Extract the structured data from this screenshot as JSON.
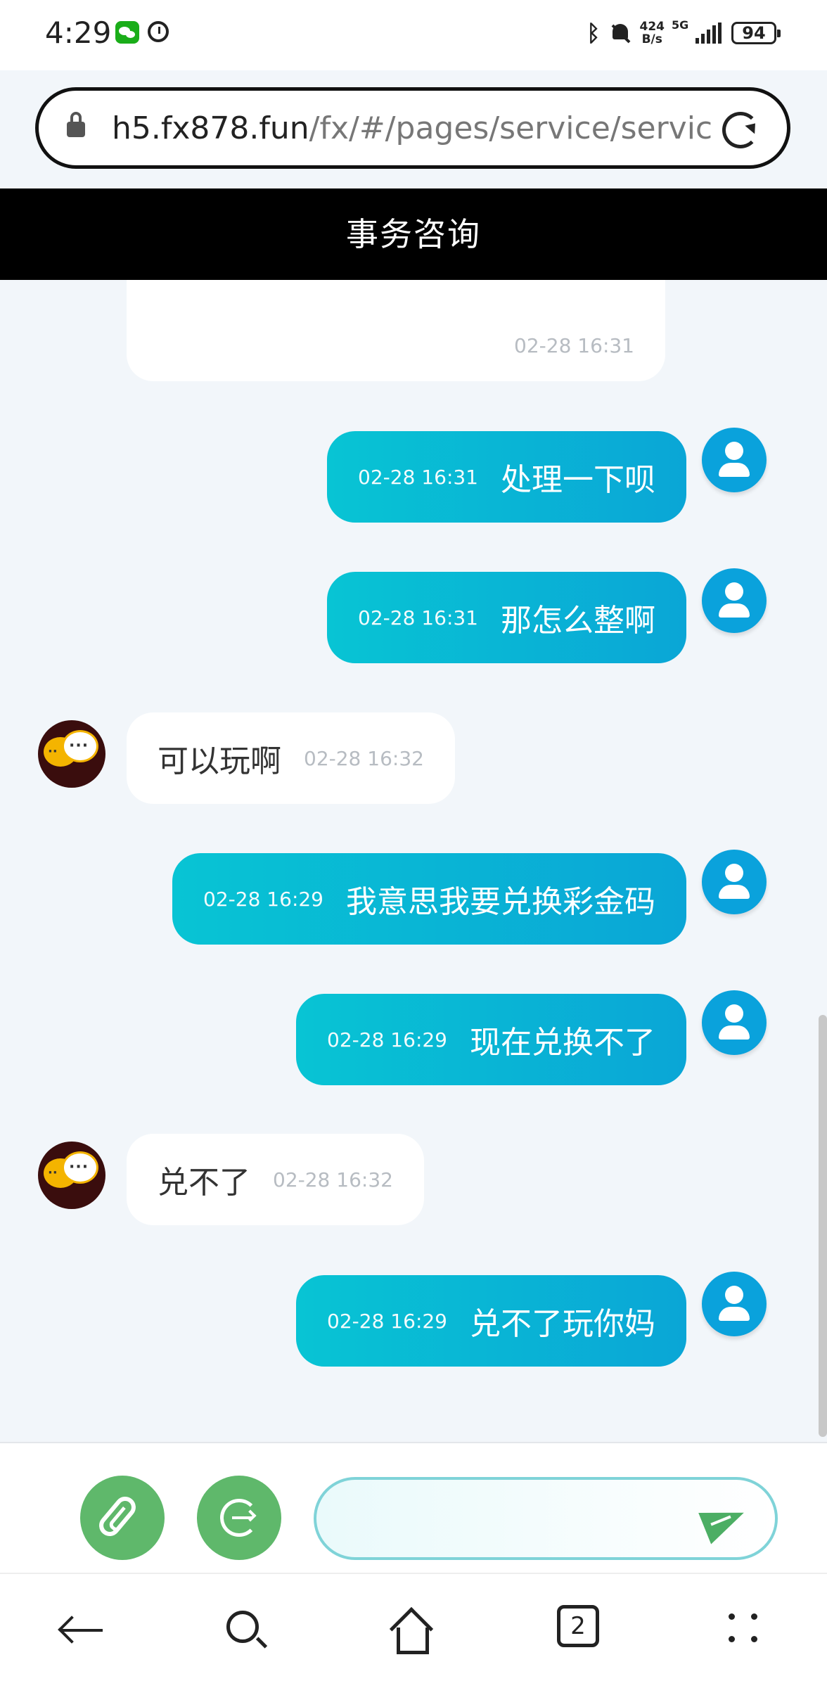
{
  "status_bar": {
    "time": "4:29",
    "icons": [
      "wechat-icon",
      "alarm-icon",
      "bluetooth-icon",
      "mute-icon",
      "signal-icon"
    ],
    "net_speed_value": "424",
    "net_speed_unit": "B/s",
    "network_type": "5G",
    "battery": "94"
  },
  "browser": {
    "url_host": "h5.fx878.fun",
    "url_path": "/fx/#/pages/service/servic"
  },
  "header": {
    "title": "事务咨询"
  },
  "messages": [
    {
      "side": "agent",
      "text": "",
      "time": "02-28 16:31"
    },
    {
      "side": "user",
      "text": "处理一下呗",
      "time": "02-28 16:31"
    },
    {
      "side": "user",
      "text": "那怎么整啊",
      "time": "02-28 16:31"
    },
    {
      "side": "agent",
      "text": "可以玩啊",
      "time": "02-28 16:32"
    },
    {
      "side": "user",
      "text": "我意思我要兑换彩金码",
      "time": "02-28 16:29"
    },
    {
      "side": "user",
      "text": "现在兑换不了",
      "time": "02-28 16:29"
    },
    {
      "side": "agent",
      "text": "兑不了",
      "time": "02-28 16:32"
    },
    {
      "side": "user",
      "text": "兑不了玩你妈",
      "time": "02-28 16:29"
    }
  ],
  "input": {
    "value": "",
    "placeholder": ""
  },
  "bottom_nav": {
    "tab_count": "2"
  },
  "colors": {
    "header_bg": "#000000",
    "user_bubble_start": "#08c4d4",
    "user_bubble_end": "#0aa6d6",
    "action_green": "#5fb86b",
    "chat_bg": "#f2f6fa"
  }
}
